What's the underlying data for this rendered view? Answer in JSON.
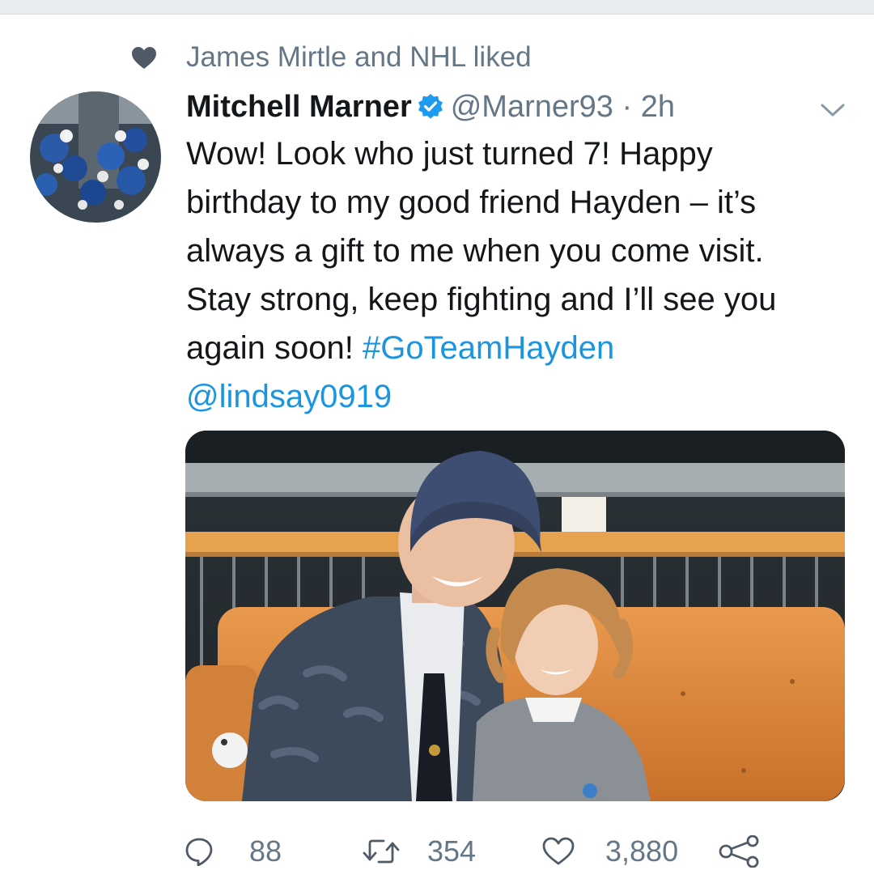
{
  "social_context": {
    "text": "James Mirtle and NHL liked",
    "icon": "heart-icon"
  },
  "tweet": {
    "author_name": "Mitchell Marner",
    "verified": true,
    "handle": "@Marner93",
    "separator": "·",
    "time": "2h",
    "lines": [
      "Wow! Look who just turned 7! Happy",
      "birthday to my good friend Hayden – it’s",
      "always a gift to me when you come visit.",
      "Stay strong, keep fighting and I’ll see you"
    ],
    "line5_text": "again soon! ",
    "hashtag": "#GoTeamHayden",
    "mention": "@lindsay0919"
  },
  "actions": {
    "reply_count": "88",
    "retweet_count": "354",
    "like_count": "3,880"
  },
  "colors": {
    "link": "#1b95e0",
    "secondary_text": "#657786",
    "primary_text": "#14171a",
    "icon_fill": "#4f5a66"
  }
}
